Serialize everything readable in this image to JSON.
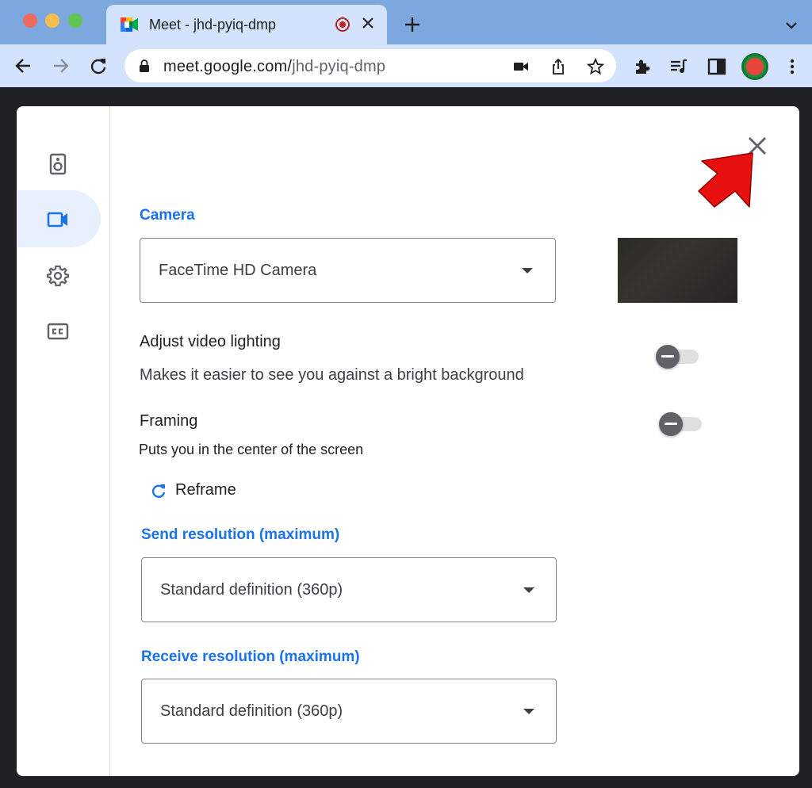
{
  "browser": {
    "tab_title": "Meet - jhd-pyiq-dmp",
    "url_host": "meet.google.com/",
    "url_path": "jhd-pyiq-dmp"
  },
  "dialog": {
    "sidebar": {
      "items": [
        {
          "icon": "speaker-icon",
          "active": false
        },
        {
          "icon": "video-camera-icon",
          "active": true
        },
        {
          "icon": "gear-icon",
          "active": false
        },
        {
          "icon": "captions-icon",
          "active": false
        }
      ]
    },
    "camera": {
      "label": "Camera",
      "selected": "FaceTime HD Camera"
    },
    "adjust_lighting": {
      "title": "Adjust video lighting",
      "description": "Makes it easier to see you against a bright background",
      "enabled": false
    },
    "framing": {
      "title": "Framing",
      "description": "Puts you in the center of the screen",
      "enabled": false,
      "reframe_label": "Reframe"
    },
    "send_resolution": {
      "label": "Send resolution (maximum)",
      "selected": "Standard definition (360p)"
    },
    "receive_resolution": {
      "label": "Receive resolution (maximum)",
      "selected": "Standard definition (360p)"
    }
  },
  "colors": {
    "accent": "#1a73e8",
    "chrome_tab": "#d3e3fd",
    "annotation_arrow": "#e8100f"
  }
}
